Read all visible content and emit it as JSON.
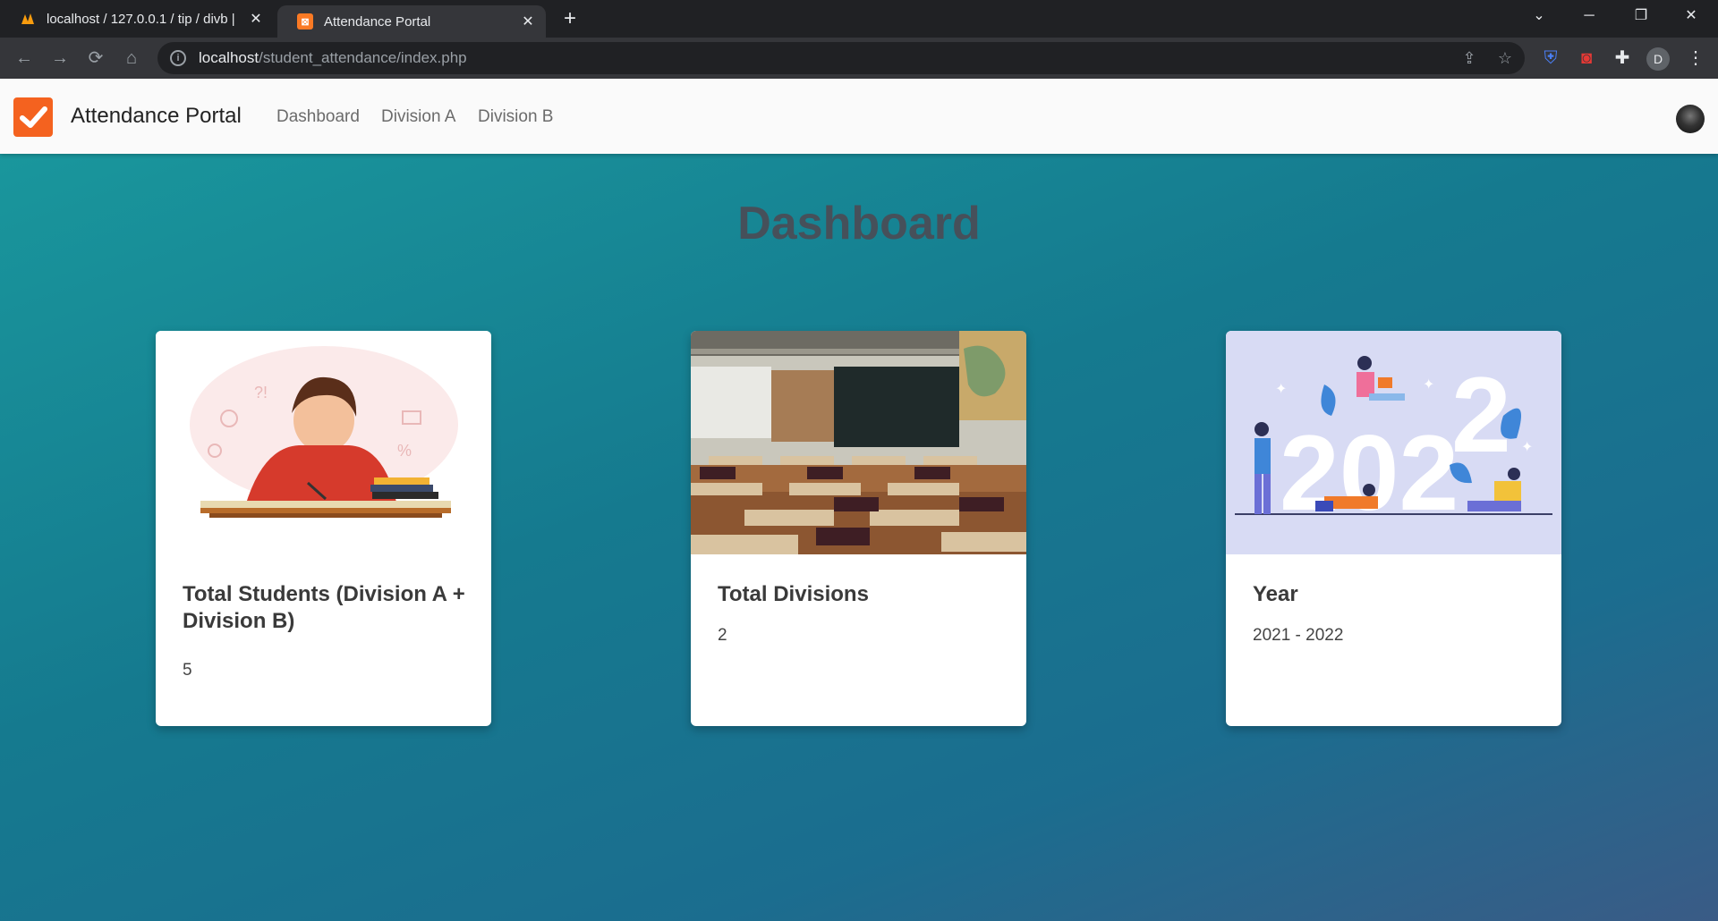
{
  "browser": {
    "tabs": [
      {
        "title": "localhost / 127.0.0.1 / tip / divb |",
        "active": false
      },
      {
        "title": "Attendance Portal",
        "active": true
      }
    ],
    "url_host": "localhost",
    "url_path": "/student_attendance/index.php",
    "profile_initial": "D"
  },
  "navbar": {
    "brand": "Attendance Portal",
    "links": [
      "Dashboard",
      "Division A",
      "Division B"
    ]
  },
  "page": {
    "title": "Dashboard"
  },
  "cards": [
    {
      "title": "Total Students (Division A + Division B)",
      "value": "5"
    },
    {
      "title": "Total Divisions",
      "value": "2"
    },
    {
      "title": "Year",
      "value": "2021 - 2022"
    }
  ],
  "colors": {
    "brand_accent": "#f4621f",
    "page_gradient_start": "#1a9a9e",
    "page_gradient_end": "#3a5b86"
  }
}
